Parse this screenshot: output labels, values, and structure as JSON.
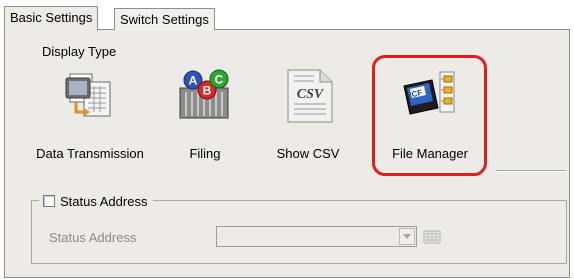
{
  "tabs": [
    {
      "label": "Basic Settings",
      "active": true
    },
    {
      "label": "Switch Settings",
      "active": false
    }
  ],
  "display_type": {
    "label": "Display Type",
    "options": [
      {
        "label": "Data Transmission",
        "icon": "data-transmission-icon"
      },
      {
        "label": "Filing",
        "icon": "filing-abc-icon"
      },
      {
        "label": "Show CSV",
        "icon": "csv-file-icon"
      },
      {
        "label": "File Manager",
        "icon": "cf-card-file-manager-icon",
        "highlighted": true
      }
    ]
  },
  "status_address": {
    "checkbox_label": "Status Address",
    "checked": false,
    "field_label": "Status Address",
    "value": ""
  },
  "colors": {
    "highlight": "#e01e1e",
    "panel": "#ecebe6"
  }
}
